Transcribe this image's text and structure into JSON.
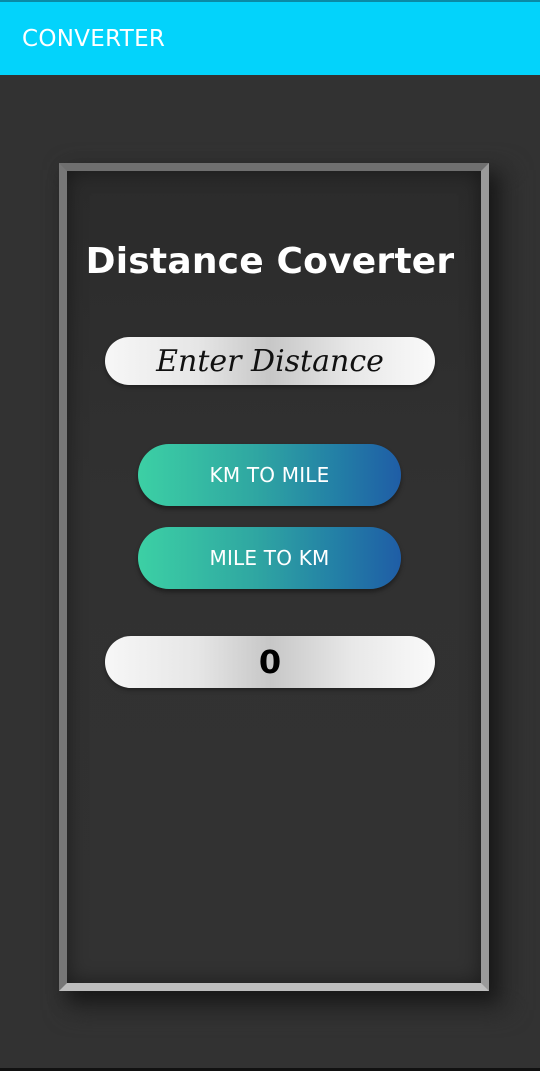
{
  "appbar": {
    "title": "CONVERTER",
    "color": "#03d3fb"
  },
  "card": {
    "title": "Distance Coverter"
  },
  "input": {
    "placeholder": "Enter Distance",
    "value": ""
  },
  "buttons": {
    "km_to_mile": "KM TO MILE",
    "mile_to_km": "MILE TO KM",
    "gradient_start": "#3cd0a4",
    "gradient_end": "#1f5da6"
  },
  "result": {
    "value": "0"
  }
}
